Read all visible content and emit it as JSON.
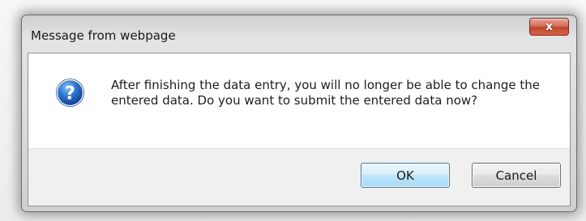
{
  "window": {
    "title": "Message from webpage",
    "close_label": "x"
  },
  "dialog": {
    "icon": "question-icon",
    "message": "After finishing the data entry, you will no longer be able to change the entered data. Do you want to submit the entered data now?"
  },
  "buttons": {
    "ok_label": "OK",
    "cancel_label": "Cancel"
  },
  "colors": {
    "close_button": "#c7472d",
    "ok_button_border": "#3c7fb1",
    "question_icon": "#1f5fb6"
  }
}
